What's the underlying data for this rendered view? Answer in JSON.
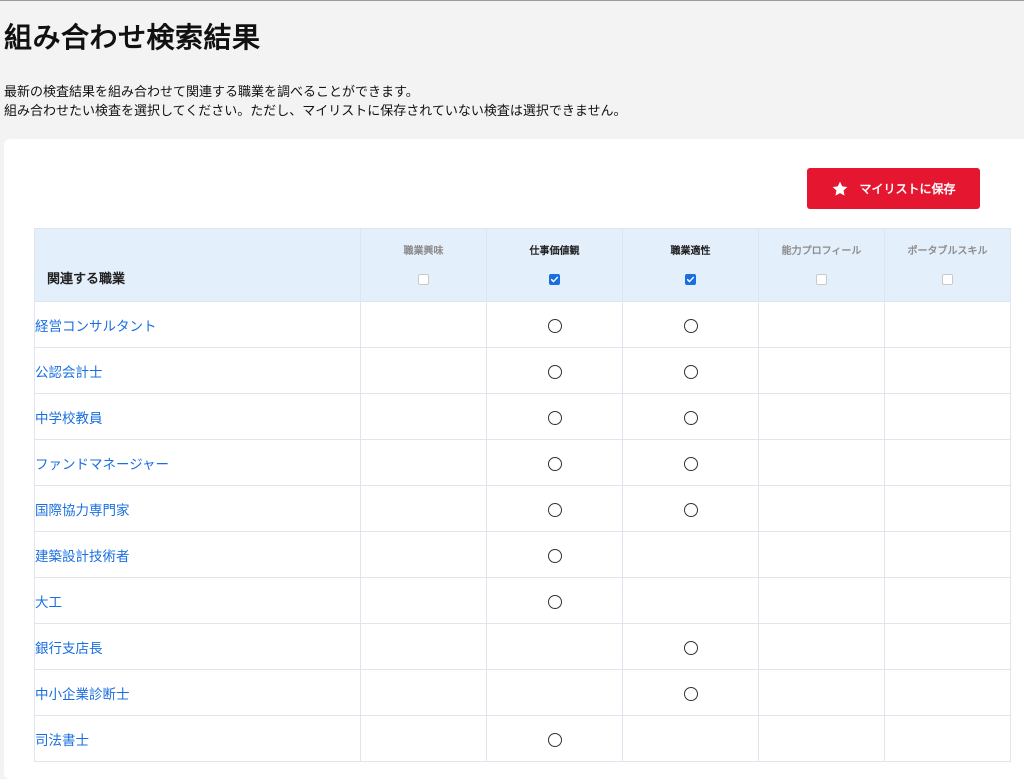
{
  "page": {
    "title": "組み合わせ検索結果",
    "description": [
      "最新の検査結果を組み合わせて関連する職業を調べることができます。",
      "組み合わせたい検査を選択してください。ただし、マイリストに保存されていない検査は選択できません。"
    ]
  },
  "actions": {
    "save_label": "マイリストに保存",
    "save_icon": "star-icon",
    "save_color": "#e5162f"
  },
  "table": {
    "occupation_header": "関連する職業",
    "columns": [
      {
        "label": "職業興味",
        "checked": false,
        "enabled": false
      },
      {
        "label": "仕事価値観",
        "checked": true,
        "enabled": true
      },
      {
        "label": "職業適性",
        "checked": true,
        "enabled": true
      },
      {
        "label": "能力プロフィール",
        "checked": false,
        "enabled": false
      },
      {
        "label": "ポータブルスキル",
        "checked": false,
        "enabled": false
      }
    ],
    "rows": [
      {
        "name": "経営コンサルタント",
        "marks": [
          "",
          "○",
          "○",
          "",
          ""
        ]
      },
      {
        "name": "公認会計士",
        "marks": [
          "",
          "○",
          "○",
          "",
          ""
        ]
      },
      {
        "name": "中学校教員",
        "marks": [
          "",
          "○",
          "○",
          "",
          ""
        ]
      },
      {
        "name": "ファンドマネージャー",
        "marks": [
          "",
          "○",
          "○",
          "",
          ""
        ]
      },
      {
        "name": "国際協力専門家",
        "marks": [
          "",
          "○",
          "○",
          "",
          ""
        ]
      },
      {
        "name": "建築設計技術者",
        "marks": [
          "",
          "○",
          "",
          "",
          ""
        ]
      },
      {
        "name": "大工",
        "marks": [
          "",
          "○",
          "",
          "",
          ""
        ]
      },
      {
        "name": "銀行支店長",
        "marks": [
          "",
          "",
          "○",
          "",
          ""
        ]
      },
      {
        "name": "中小企業診断士",
        "marks": [
          "",
          "",
          "○",
          "",
          ""
        ]
      },
      {
        "name": "司法書士",
        "marks": [
          "",
          "○",
          "",
          "",
          ""
        ]
      }
    ]
  },
  "colors": {
    "link": "#1a6fe0",
    "header_bg": "#e4effc",
    "checkbox_checked": "#1a6fe0"
  }
}
